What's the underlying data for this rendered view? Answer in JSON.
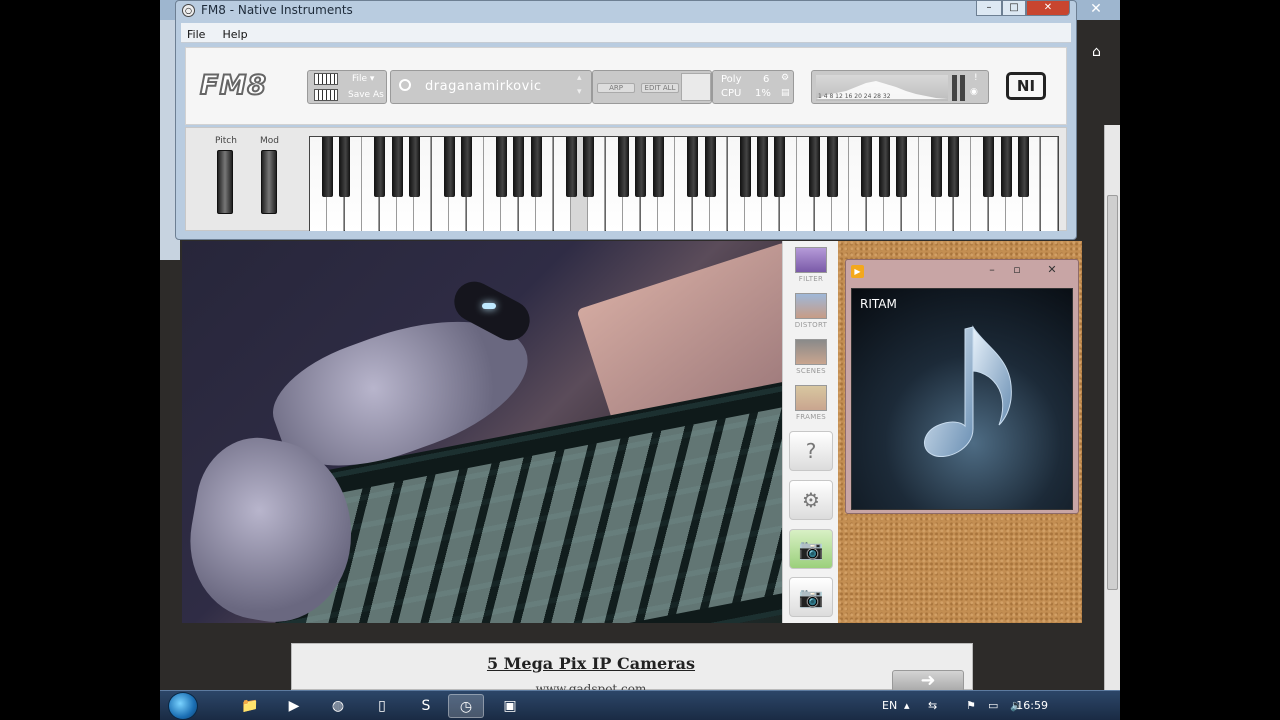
{
  "fm8": {
    "window_title": "FM8 - Native Instruments",
    "menu": [
      "File",
      "Help"
    ],
    "logo": "FM8",
    "file_label": "File ▾",
    "save_as_label": "Save As",
    "preset": "draganamirkovic",
    "arp_label": "ARP",
    "edit_all_label": "EDIT ALL",
    "poly_label": "Poly",
    "poly_value": "6",
    "cpu_label": "CPU",
    "cpu_value": "1%",
    "meter_ticks": "1  4  8  12  16  20  24  28  32",
    "ni_logo": "NI",
    "pitch_label": "Pitch",
    "mod_label": "Mod"
  },
  "webcam_sidebar": {
    "items": [
      "FILTER",
      "DISTORT",
      "SCENES",
      "FRAMES"
    ]
  },
  "player": {
    "track": "RITAM"
  },
  "ad": {
    "title": "5 Mega Pix IP Cameras",
    "url": "www.gadspot.com",
    "arrow": "➜"
  },
  "taskbar": {
    "language": "EN",
    "time": "16:59"
  },
  "colors": {
    "desktop_bg": "#000000",
    "fm8_frame": "#b9cce0",
    "close_button": "#c8452f",
    "taskbar": "#1a2b44"
  }
}
